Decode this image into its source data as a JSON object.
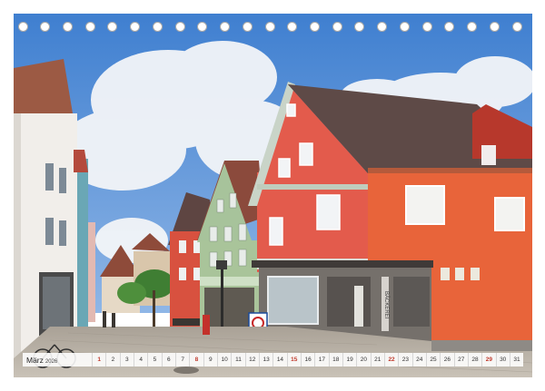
{
  "calendar": {
    "month": "März",
    "year": "2026",
    "days": [
      {
        "n": "1",
        "sun": true
      },
      {
        "n": "2"
      },
      {
        "n": "3"
      },
      {
        "n": "4"
      },
      {
        "n": "5"
      },
      {
        "n": "6"
      },
      {
        "n": "7"
      },
      {
        "n": "8",
        "sun": true
      },
      {
        "n": "9"
      },
      {
        "n": "10"
      },
      {
        "n": "11"
      },
      {
        "n": "12"
      },
      {
        "n": "13"
      },
      {
        "n": "14"
      },
      {
        "n": "15",
        "sun": true
      },
      {
        "n": "16"
      },
      {
        "n": "17"
      },
      {
        "n": "18"
      },
      {
        "n": "19"
      },
      {
        "n": "20"
      },
      {
        "n": "21"
      },
      {
        "n": "22",
        "sun": true
      },
      {
        "n": "23"
      },
      {
        "n": "24"
      },
      {
        "n": "25"
      },
      {
        "n": "26"
      },
      {
        "n": "27"
      },
      {
        "n": "28"
      },
      {
        "n": "29",
        "sun": true
      },
      {
        "n": "30"
      },
      {
        "n": "31"
      }
    ]
  },
  "binding": {
    "hole_count": 23
  },
  "photo": {
    "colors": {
      "sky": "#4b8ad6",
      "cloud": "#f3f5f8",
      "red_facade": "#e35b4c",
      "orange_facade": "#e8643a",
      "green_facade": "#a9c49a",
      "roof": "#5b4a48",
      "cobblestone": "#b9b2a8"
    },
    "sign_text": "BÄCKEREI"
  }
}
